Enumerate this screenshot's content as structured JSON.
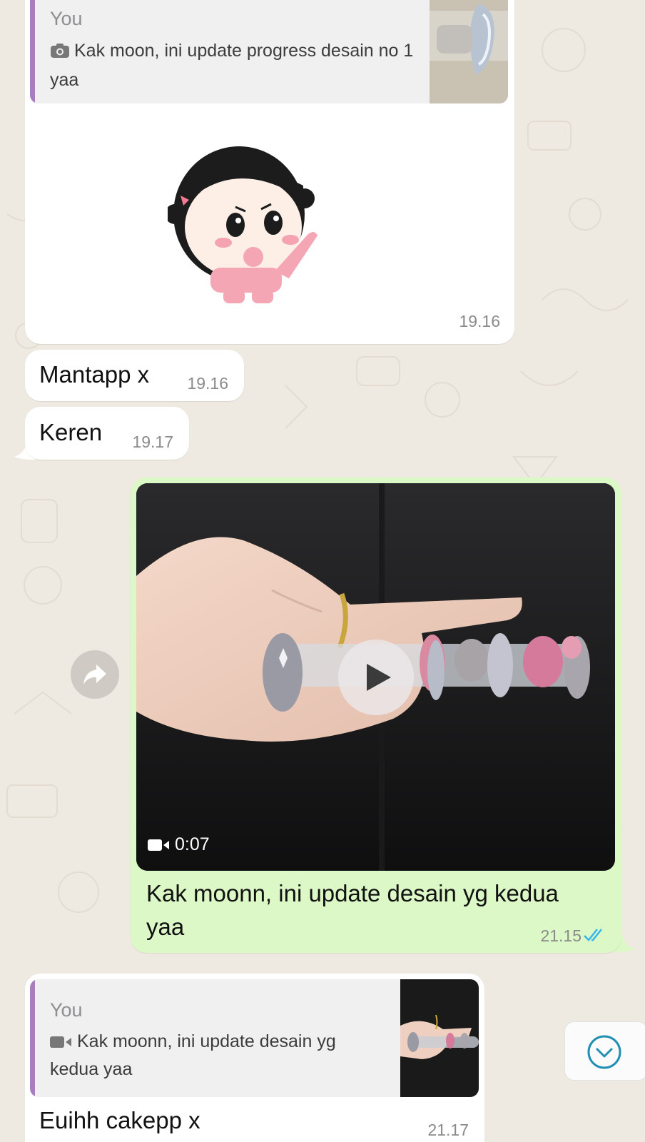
{
  "messages": [
    {
      "quote": {
        "sender": "You",
        "text": "Kak moon, ini update progress desain no 1 yaa",
        "icon": "camera-icon"
      },
      "sticker": "sticker-baby-thumbs-up",
      "time": "19.16"
    },
    {
      "text": "Mantapp x",
      "time": "19.16"
    },
    {
      "text": "Keren",
      "time": "19.17"
    },
    {
      "video_duration": "0:07",
      "caption_line1": "Kak moonn, ini update desain yg kedua",
      "caption_line2": "yaa",
      "time": "21.15",
      "status": "read"
    },
    {
      "quote": {
        "sender": "You",
        "text_line1": "Kak moonn, ini update desain yg",
        "text_line2": "kedua yaa",
        "icon": "video-icon"
      },
      "text": "Euihh cakepp x",
      "time": "21.17"
    }
  ],
  "colors": {
    "background": "#eee9e1",
    "incoming": "#ffffff",
    "outgoing": "#dcf8c6",
    "quote_bar": "#a87fbd",
    "read_tick": "#34b7f1",
    "scroll_button_icon": "#1f8fb4"
  }
}
